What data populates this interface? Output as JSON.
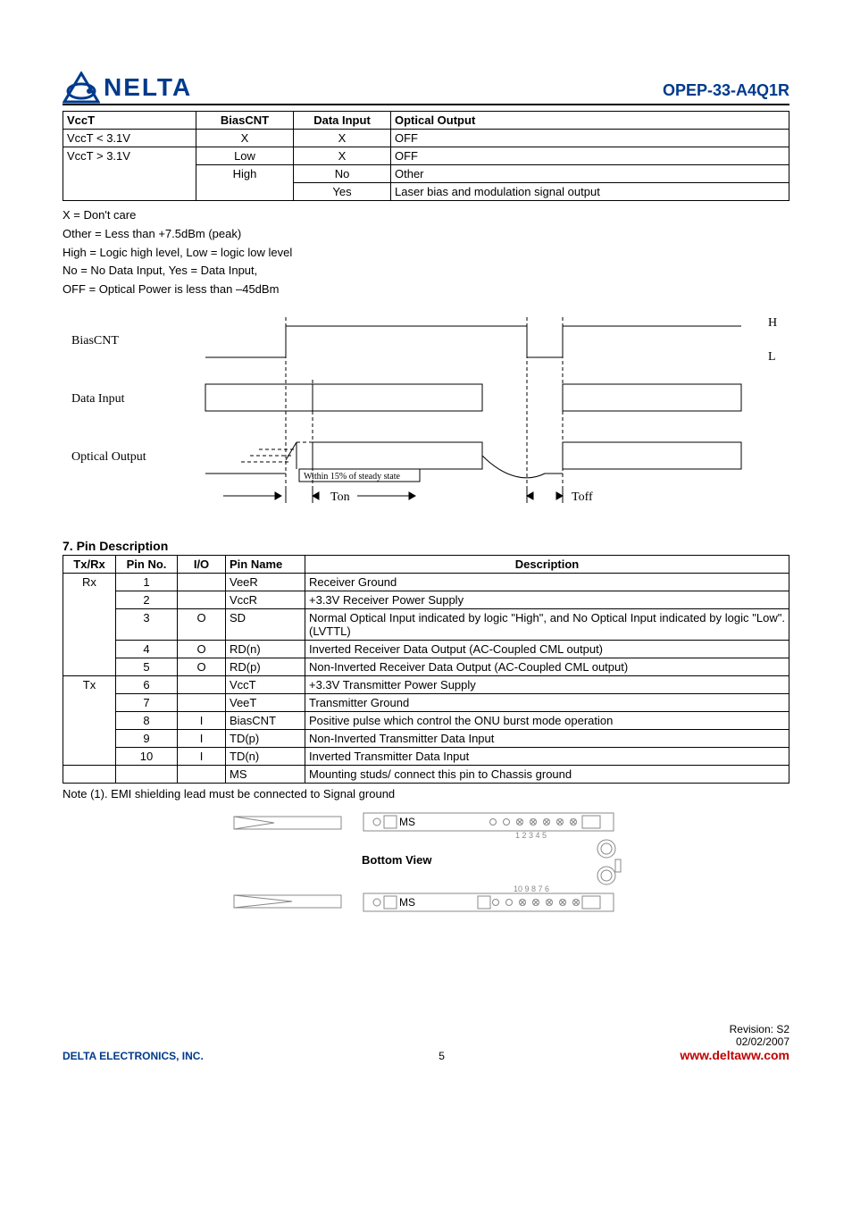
{
  "header": {
    "logo_text": "NELTA",
    "part_number": "OPEP-33-A4Q1R"
  },
  "table1": {
    "headers": [
      "VccT",
      "BiasCNT",
      "Data Input",
      "Optical Output"
    ],
    "rows": [
      [
        "VccT < 3.1V",
        "X",
        "X",
        "OFF"
      ],
      [
        "VccT > 3.1V",
        "Low",
        "X",
        "OFF"
      ],
      [
        "",
        "High",
        "No",
        "Other"
      ],
      [
        "",
        "",
        "Yes",
        "Laser bias and modulation signal output"
      ]
    ]
  },
  "notes": [
    "X = Don't care",
    "Other = Less than +7.5dBm (peak)",
    "High = Logic high level, Low = logic low level",
    "No = No Data Input, Yes = Data Input,",
    "OFF = Optical Power is less than –45dBm"
  ],
  "timing": {
    "BiasCNT": "BiasCNT",
    "DataInput": "Data Input",
    "OpticalOutput": "Optical Output",
    "H": "H",
    "L": "L",
    "steady": "Within 15% of steady state",
    "Ton": "Ton",
    "Toff": "Toff"
  },
  "section7": "7. Pin Description",
  "table2": {
    "headers": [
      "Tx/Rx",
      "Pin No.",
      "I/O",
      "Pin Name",
      "Description"
    ],
    "rows": [
      [
        "Rx",
        "1",
        "",
        "VeeR",
        "Receiver Ground"
      ],
      [
        "",
        "2",
        "",
        "VccR",
        "+3.3V Receiver Power Supply"
      ],
      [
        "",
        "3",
        "O",
        "SD",
        "Normal Optical Input indicated by logic \"High\", and No Optical Input indicated by logic \"Low\". (LVTTL)"
      ],
      [
        "",
        "4",
        "O",
        "RD(n)",
        "Inverted Receiver Data Output (AC-Coupled CML output)"
      ],
      [
        "",
        "5",
        "O",
        "RD(p)",
        "Non-Inverted Receiver Data Output (AC-Coupled CML output)"
      ],
      [
        "Tx",
        "6",
        "",
        "VccT",
        "+3.3V Transmitter Power Supply"
      ],
      [
        "",
        "7",
        "",
        "VeeT",
        "Transmitter Ground"
      ],
      [
        "",
        "8",
        "I",
        "BiasCNT",
        "Positive pulse which control the ONU burst mode operation"
      ],
      [
        "",
        "9",
        "I",
        "TD(p)",
        "Non-Inverted Transmitter Data Input"
      ],
      [
        "",
        "10",
        "I",
        "TD(n)",
        "Inverted Transmitter Data Input"
      ],
      [
        "",
        "",
        "",
        "MS",
        "Mounting studs/ connect this pin to Chassis ground"
      ]
    ]
  },
  "note1": "Note (1). EMI shielding lead must be connected to Signal ground",
  "bottomview": {
    "MS": "MS",
    "title": "Bottom View",
    "nums_top": "1 2 3 4 5",
    "nums_bot": "10 9 8 7 6"
  },
  "footer": {
    "page": "5",
    "rev": "Revision:  S2",
    "date": "02/02/2007",
    "company": "DELTA ELECTRONICS, INC.",
    "www": "www.deltaww.com"
  }
}
